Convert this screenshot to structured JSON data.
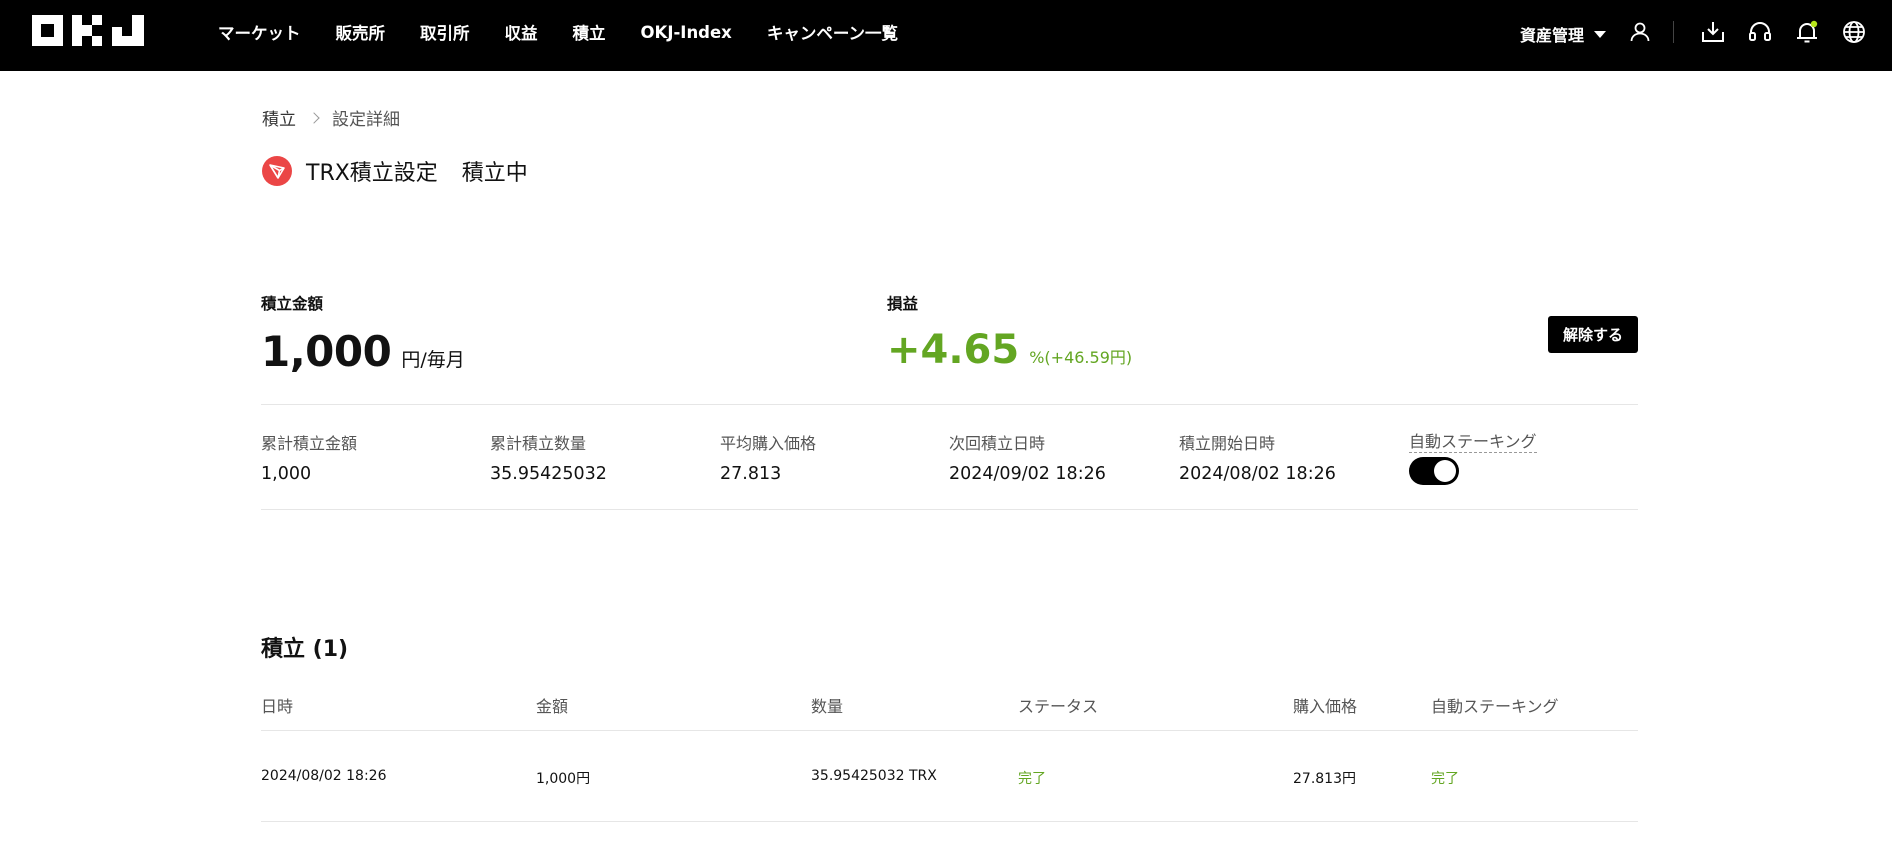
{
  "nav": {
    "logo_alt": "OKJ",
    "items": [
      {
        "label": "マーケット"
      },
      {
        "label": "販売所"
      },
      {
        "label": "取引所"
      },
      {
        "label": "収益"
      },
      {
        "label": "積立"
      },
      {
        "label": "OKJ-Index"
      },
      {
        "label": "キャンペーン一覧"
      }
    ],
    "assets_label": "資産管理",
    "icons": [
      "user-icon",
      "download-icon",
      "headset-icon",
      "bell-icon",
      "globe-icon"
    ],
    "notification_dot_color": "#b7e51a"
  },
  "breadcrumb": {
    "root": "積立",
    "current": "設定詳細"
  },
  "plan": {
    "title": "TRX積立設定",
    "status": "積立中",
    "coin_color": "#eb4646"
  },
  "summary": {
    "amount_label": "積立金額",
    "amount_value": "1,000",
    "amount_unit": "円/毎月",
    "pnl_label": "損益",
    "pnl_value": "+4.65",
    "pnl_sub": "%(+46.59円)",
    "pnl_color": "#63a622",
    "cancel_button": "解除する"
  },
  "stats": [
    {
      "label": "累計積立金額",
      "value": "1,000"
    },
    {
      "label": "累計積立数量",
      "value": "35.95425032"
    },
    {
      "label": "平均購入価格",
      "value": "27.813"
    },
    {
      "label": "次回積立日時",
      "value": "2024/09/02 18:26"
    },
    {
      "label": "積立開始日時",
      "value": "2024/08/02 18:26"
    }
  ],
  "auto_staking": {
    "label": "自動ステーキング",
    "enabled": true
  },
  "history": {
    "title": "積立 (1)",
    "columns": [
      "日時",
      "金額",
      "数量",
      "ステータス",
      "購入価格",
      "自動ステーキング"
    ],
    "rows": [
      [
        "2024/08/02 18:26",
        "1,000円",
        "35.95425032 TRX",
        "完了",
        "27.813円",
        "完了"
      ]
    ]
  }
}
